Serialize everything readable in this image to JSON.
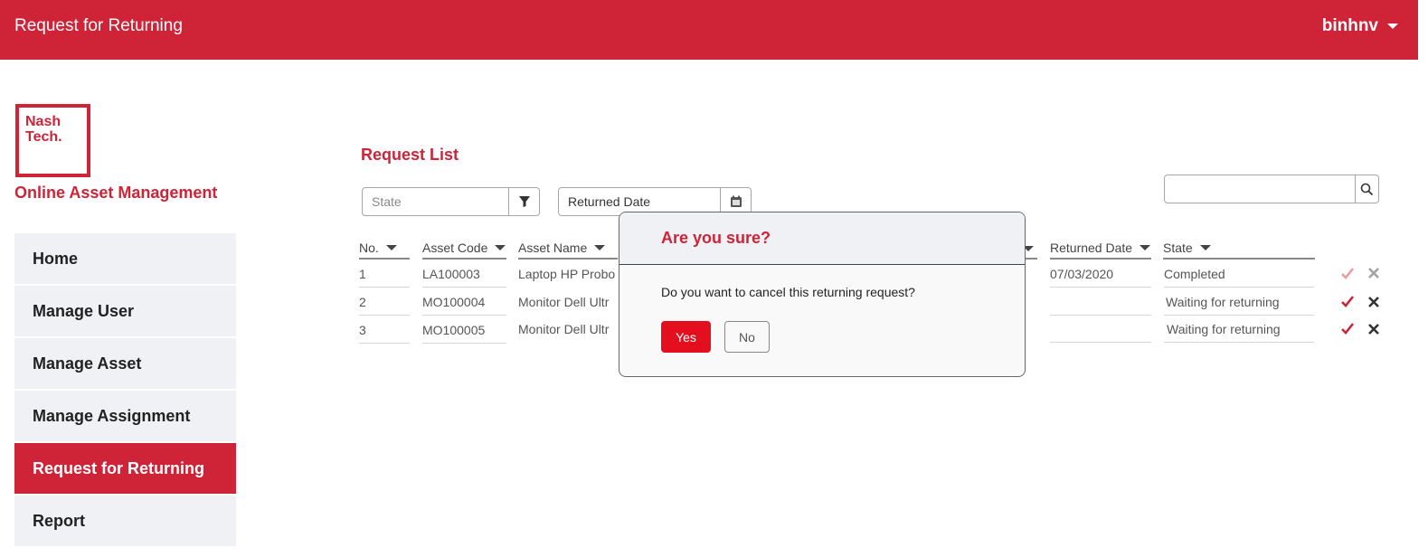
{
  "header": {
    "title": "Request for Returning",
    "user": "binhnv"
  },
  "sidebar": {
    "logo_line1": "Nash",
    "logo_line2": "Tech.",
    "app_name": "Online Asset Management",
    "items": [
      {
        "label": "Home"
      },
      {
        "label": "Manage User"
      },
      {
        "label": "Manage Asset"
      },
      {
        "label": "Manage Assignment"
      },
      {
        "label": "Request for Returning"
      },
      {
        "label": "Report"
      }
    ],
    "active_index": 4
  },
  "main": {
    "title": "Request List",
    "filters": {
      "state_placeholder": "State",
      "returned_date_value": "Returned Date"
    },
    "search": {
      "value": "",
      "placeholder": ""
    },
    "columns": {
      "no": "No.",
      "asset_code": "Asset Code",
      "asset_name": "Asset Name",
      "returned_date": "Returned Date",
      "state": "State"
    },
    "rows": [
      {
        "no": "1",
        "asset_code": "LA100003",
        "asset_name": "Laptop HP Probo",
        "returned_date": "07/03/2020",
        "state": "Completed"
      },
      {
        "no": "2",
        "asset_code": "MO100004",
        "asset_name": "Monitor Dell Ultr",
        "returned_date": "",
        "state": "Waiting for returning"
      },
      {
        "no": "3",
        "asset_code": "MO100005",
        "asset_name": "Monitor Dell Ultr",
        "returned_date": "",
        "state": "Waiting for returning"
      }
    ]
  },
  "modal": {
    "title": "Are you sure?",
    "message": "Do you want to cancel this returning request?",
    "yes_label": "Yes",
    "no_label": "No"
  },
  "colors": {
    "brand": "#cf2338",
    "danger_button": "#e30f1f",
    "nav_bg": "#eff1f5"
  }
}
